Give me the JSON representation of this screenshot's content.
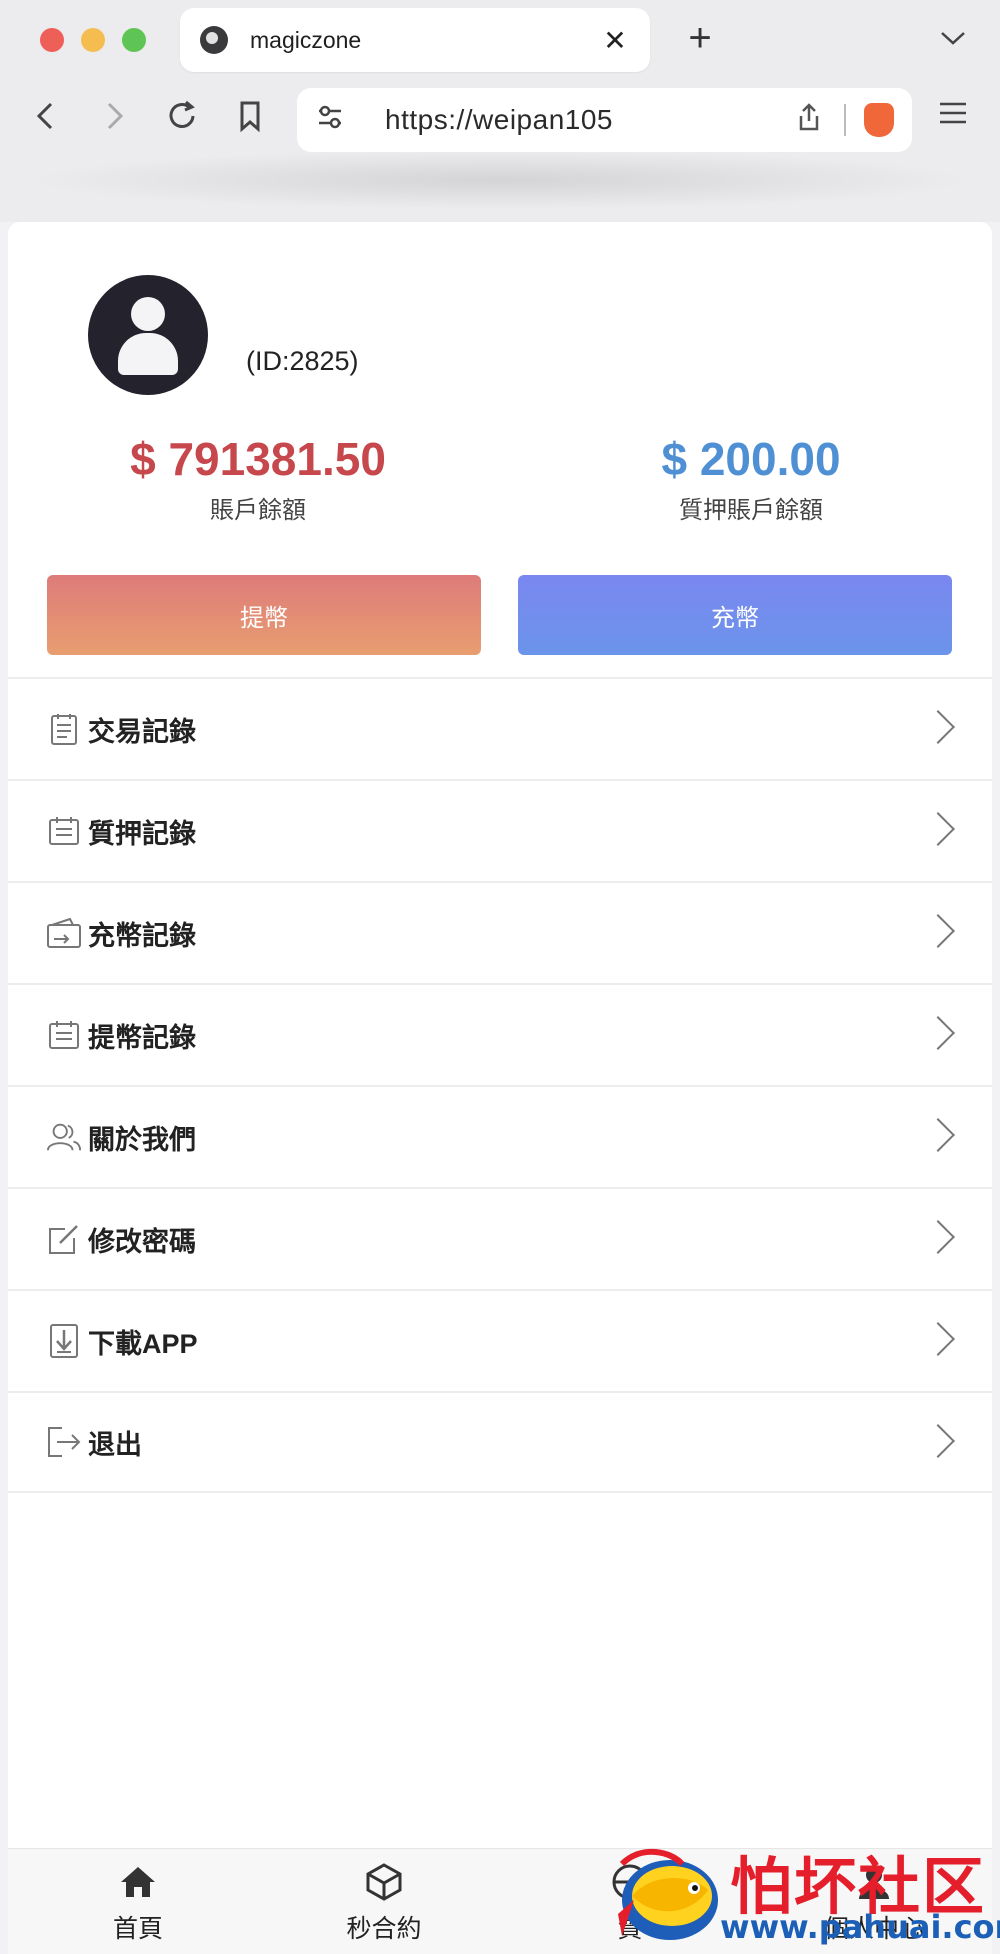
{
  "browser": {
    "tab_title": "magiczone",
    "url": "https://weipan105",
    "close_glyph": "✕",
    "new_tab_glyph": "+",
    "tab_menu_glyph": "⌄",
    "back_glyph": "‹",
    "forward_glyph": "›",
    "reload_glyph": "↻",
    "menu_glyph": "≡",
    "share_glyph": "⇪",
    "tune_glyph": "⚙"
  },
  "profile": {
    "user_id": "(ID:2825)"
  },
  "balances": {
    "account_amount": "$ 791381.50",
    "account_label": "賬戶餘額",
    "pledge_amount": "$ 200.00",
    "pledge_label": "質押賬戶餘額"
  },
  "actions": {
    "withdraw_label": "提幣",
    "deposit_label": "充幣"
  },
  "menu": {
    "items": [
      {
        "label": "交易記錄",
        "icon": "clipboard-icon"
      },
      {
        "label": "質押記錄",
        "icon": "calendar-list-icon"
      },
      {
        "label": "充幣記錄",
        "icon": "wallet-icon"
      },
      {
        "label": "提幣記錄",
        "icon": "calendar-list-icon"
      },
      {
        "label": "關於我們",
        "icon": "users-icon"
      },
      {
        "label": "修改密碼",
        "icon": "edit-icon"
      },
      {
        "label": "下載APP",
        "icon": "download-icon"
      },
      {
        "label": "退出",
        "icon": "logout-icon"
      }
    ]
  },
  "bottom_nav": {
    "home": "首頁",
    "second_contract": "秒合約",
    "third": "質",
    "profile": "個人中心"
  },
  "watermark": {
    "title": "怕坏社区",
    "url": "www.pahuai.com"
  },
  "colors": {
    "account_amount": "#c6474c",
    "pledge_amount": "#4f8fd3",
    "withdraw_gradient": [
      "#de7b7a",
      "#e89e70"
    ],
    "deposit_gradient": [
      "#7a87f0",
      "#6b94ea"
    ]
  }
}
